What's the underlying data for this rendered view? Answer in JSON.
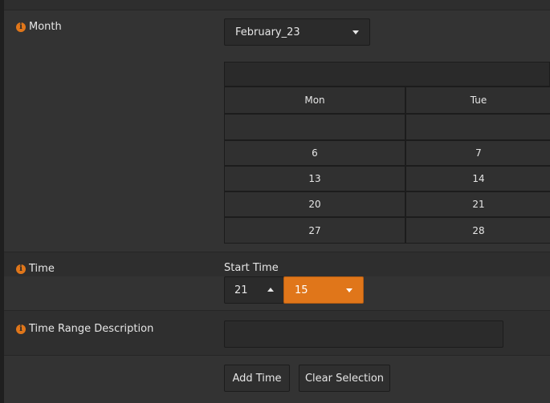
{
  "month": {
    "label": "Month",
    "selected": "February_23"
  },
  "calendar": {
    "headers": [
      "Mon",
      "Tue"
    ],
    "rows": [
      [
        "",
        ""
      ],
      [
        "6",
        "7"
      ],
      [
        "13",
        "14"
      ],
      [
        "20",
        "21"
      ],
      [
        "27",
        "28"
      ]
    ]
  },
  "time": {
    "label": "Time",
    "start_label": "Start Time",
    "hour": "21",
    "minute": "15"
  },
  "range": {
    "label": "Time Range Description",
    "value": ""
  },
  "actions": {
    "add": "Add Time",
    "clear": "Clear Selection"
  },
  "colors": {
    "accent": "#e0761a",
    "background": "#2b2b2b",
    "panel": "#333333"
  }
}
